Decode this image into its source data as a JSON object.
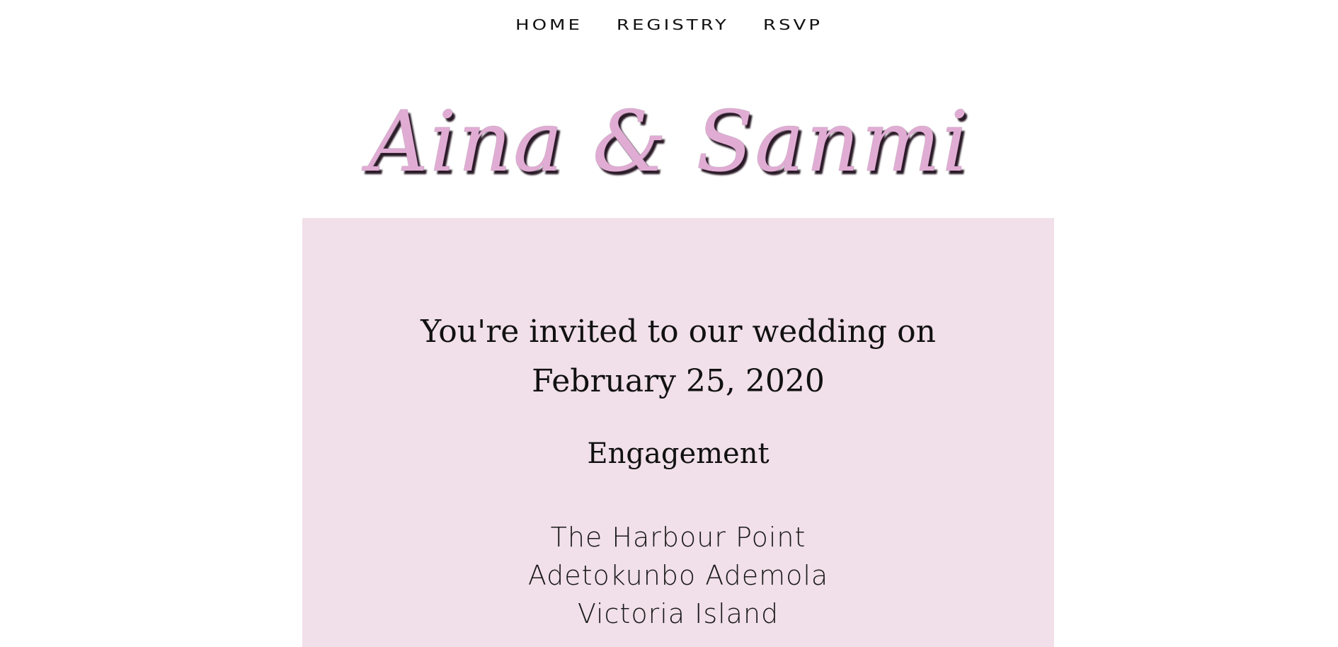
{
  "nav": {
    "items": [
      {
        "label": "HOME"
      },
      {
        "label": "REGISTRY"
      },
      {
        "label": "RSVP"
      }
    ]
  },
  "header": {
    "names": "Aina & Sanmi",
    "names_color": "#e0acd4"
  },
  "card": {
    "background": "#f1dfe9",
    "invite_line1": "You're invited to our wedding on",
    "invite_line2": "February 25, 2020",
    "event_title": "Engagement",
    "venue": [
      "The Harbour Point",
      "Adetokunbo Ademola",
      "Victoria Island"
    ]
  }
}
